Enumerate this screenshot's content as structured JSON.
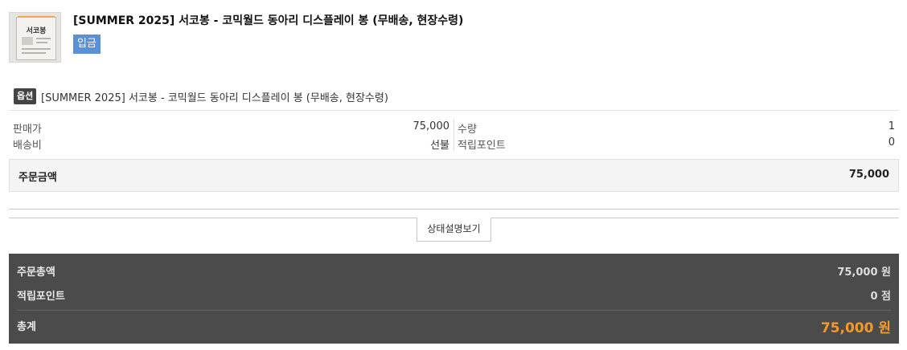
{
  "product": {
    "thumb_label": "서코봉",
    "title": "[SUMMER 2025] 서코봉 - 코믹월드 동아리 디스플레이 봉 (무배송, 현장수령)",
    "status": "입금"
  },
  "option": {
    "badge": "옵션",
    "text": "[SUMMER 2025] 서코봉 - 코믹월드 동아리 디스플레이 봉 (무배송, 현장수령)"
  },
  "details": {
    "price_label": "판매가",
    "price_value": "75,000",
    "shipping_label": "배송비",
    "shipping_value": "선불",
    "qty_label": "수량",
    "qty_value": "1",
    "points_label": "적립포인트",
    "points_value": "0"
  },
  "order_amount": {
    "label": "주문금액",
    "value": "75,000"
  },
  "status_desc_button": "상태설명보기",
  "totals": {
    "order_total_label": "주문총액",
    "order_total_value": "75,000 원",
    "points_label": "적립포인트",
    "points_value": "0 점",
    "sum_label": "총계",
    "sum_value": "75,000 원"
  },
  "colors": {
    "status_badge": "#5b8fd6",
    "totals_bg": "#4b4b4b",
    "grand_total": "#f59a2a"
  }
}
